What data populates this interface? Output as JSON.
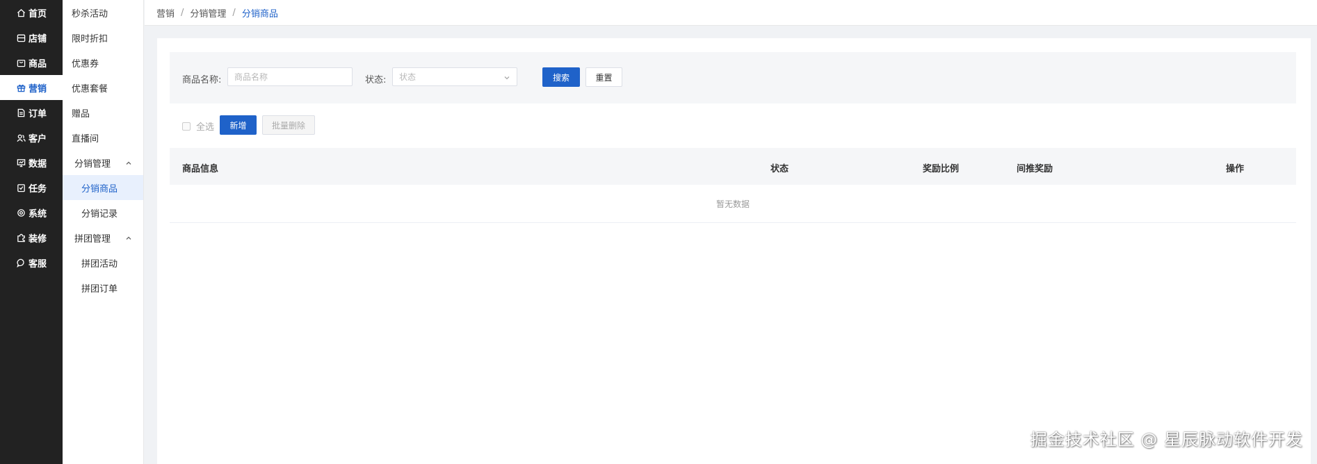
{
  "nav_primary": [
    {
      "label": "首页",
      "icon": "home-icon",
      "active": false
    },
    {
      "label": "店铺",
      "icon": "store-icon",
      "active": false
    },
    {
      "label": "商品",
      "icon": "bag-icon",
      "active": false
    },
    {
      "label": "营销",
      "icon": "gift-icon",
      "active": true
    },
    {
      "label": "订单",
      "icon": "document-icon",
      "active": false
    },
    {
      "label": "客户",
      "icon": "users-icon",
      "active": false
    },
    {
      "label": "数据",
      "icon": "chart-icon",
      "active": false
    },
    {
      "label": "任务",
      "icon": "task-icon",
      "active": false
    },
    {
      "label": "系统",
      "icon": "gear-icon",
      "active": false
    },
    {
      "label": "装修",
      "icon": "puzzle-icon",
      "active": false
    },
    {
      "label": "客服",
      "icon": "chat-icon",
      "active": false
    }
  ],
  "nav_secondary": {
    "items": [
      "秒杀活动",
      "限时折扣",
      "优惠券",
      "优惠套餐",
      "赠品",
      "直播间"
    ],
    "group1": {
      "label": "分销管理",
      "children": [
        "分销商品",
        "分销记录"
      ]
    },
    "group2": {
      "label": "拼团管理",
      "children": [
        "拼团活动",
        "拼团订单"
      ]
    }
  },
  "breadcrumb": [
    "营销",
    "分销管理",
    "分销商品"
  ],
  "filter": {
    "name_label": "商品名称:",
    "name_placeholder": "商品名称",
    "status_label": "状态:",
    "status_placeholder": "状态",
    "search_button": "搜索",
    "reset_button": "重置"
  },
  "toolbar": {
    "select_all": "全选",
    "add_button": "新增",
    "batch_delete_button": "批量删除"
  },
  "table": {
    "columns": [
      "商品信息",
      "状态",
      "奖励比例",
      "间推奖励",
      "操作"
    ],
    "empty_text": "暂无数据"
  },
  "watermark": "掘金技术社区 @ 星辰脉动软件开发",
  "colors": {
    "primary": "#1f62c9",
    "sidebar_bg": "#222222",
    "active_sub_bg": "#e8f0fd"
  }
}
